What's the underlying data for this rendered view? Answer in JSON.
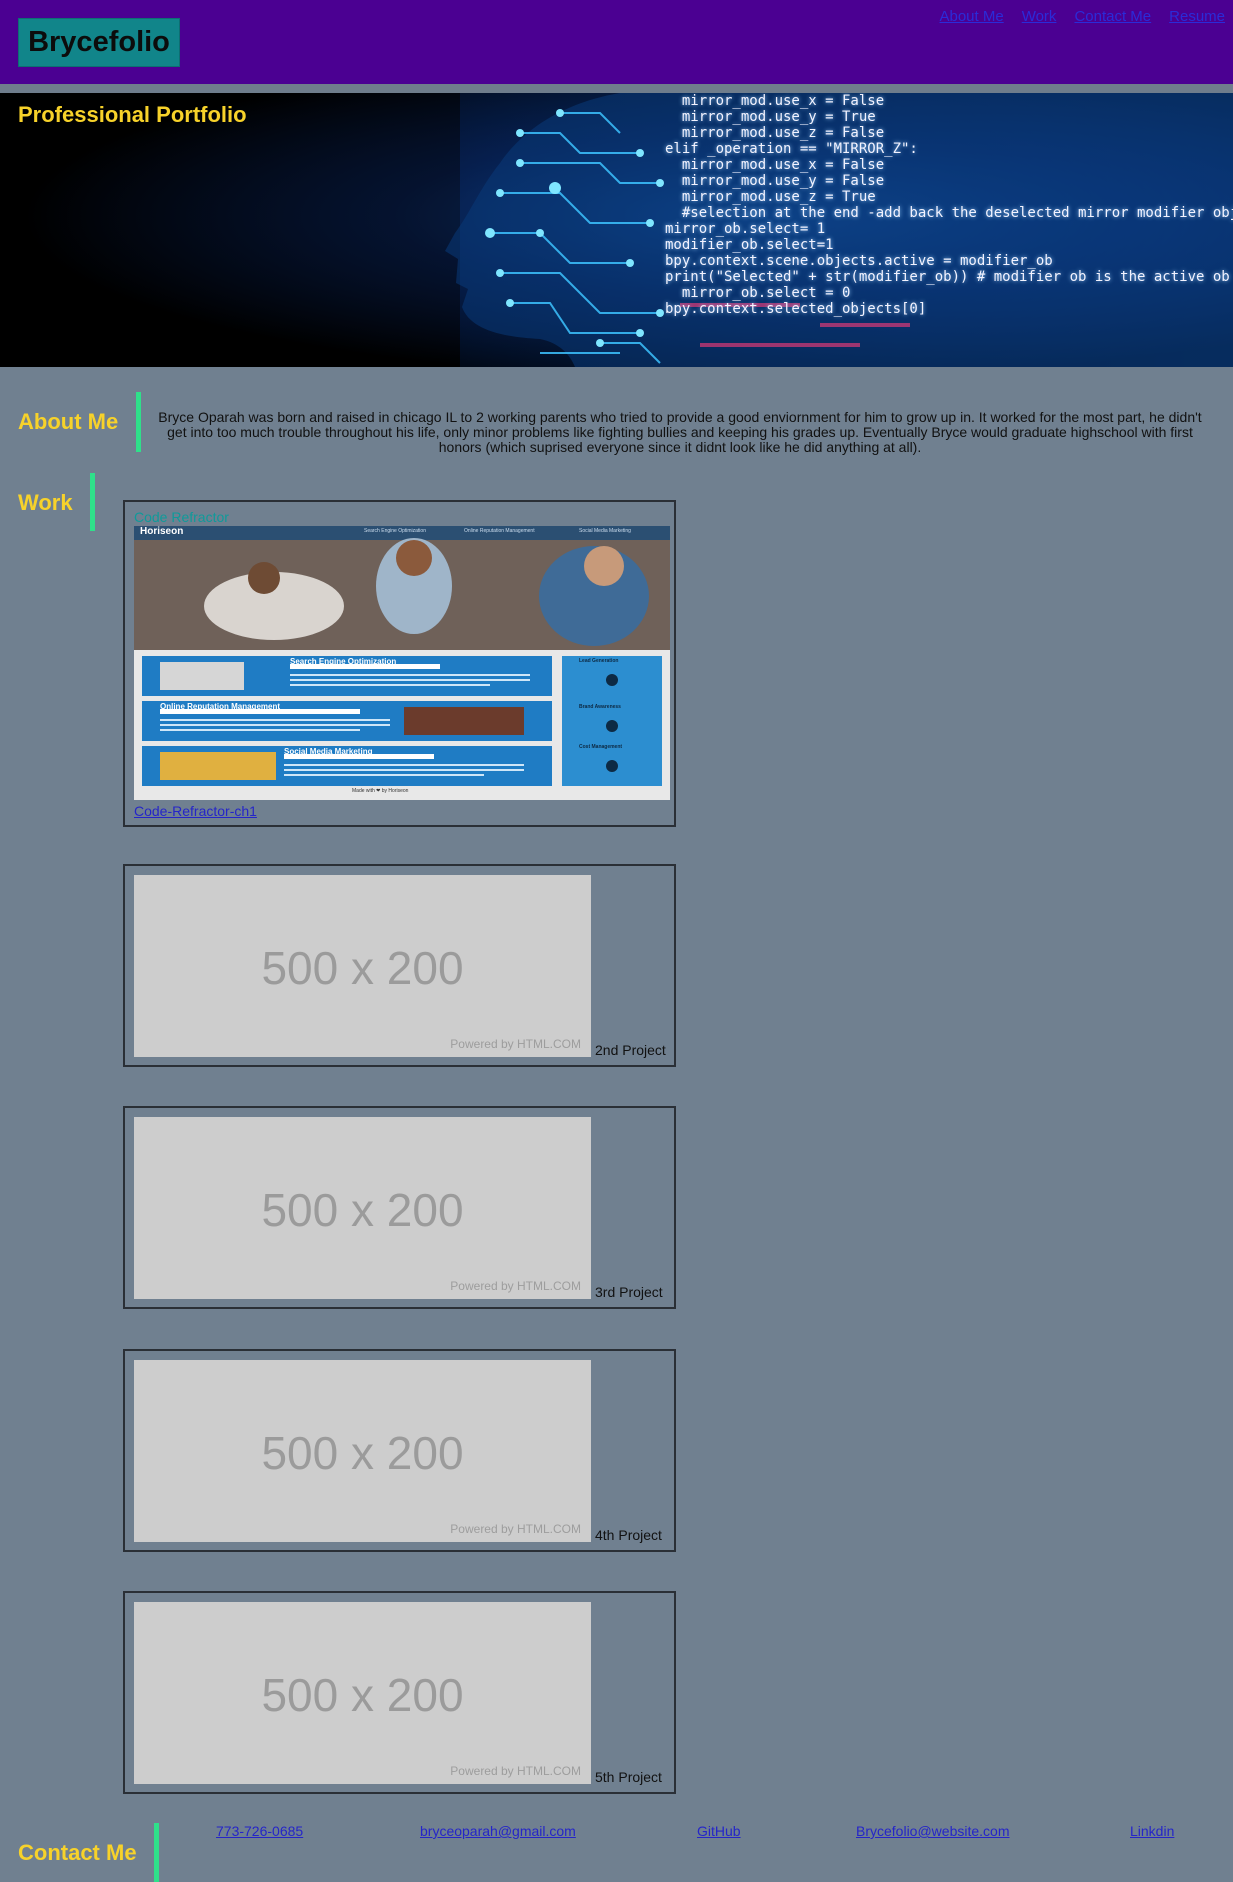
{
  "header": {
    "logo": "Brycefolio",
    "nav": [
      "About Me",
      "Work",
      "Contact Me",
      "Resume"
    ]
  },
  "hero": {
    "title": "Professional Portfolio",
    "code_lines": [
      "  mirror_mod.use_x = False",
      "  mirror_mod.use_y = True",
      "  mirror_mod.use_z = False",
      "elif _operation == \"MIRROR_Z\":",
      "  mirror_mod.use_x = False",
      "  mirror_mod.use_y = False",
      "  mirror_mod.use_z = True",
      "",
      "  #selection at the end -add back the deselected mirror modifier object",
      "mirror_ob.select= 1",
      "modifier_ob.select=1",
      "bpy.context.scene.objects.active = modifier_ob",
      "print(\"Selected\" + str(modifier_ob)) # modifier ob is the active ob",
      "  mirror_ob.select = 0",
      "bpy.context.selected_objects[0]"
    ]
  },
  "about": {
    "heading": "About Me",
    "text": "Bryce Oparah was born and raised in chicago IL to 2 working parents who tried to provide a good enviornment for him to grow up in. It worked for the most part, he didn't get into too much trouble throughout his life, only minor problems like fighting bullies and keeping his grades up. Eventually Bryce would graduate highschool with first honors (which suprised everyone since it didnt look like he did anything at all)."
  },
  "work": {
    "heading": "Work",
    "featured": {
      "title": "Code Refractor",
      "link": "Code-Refractor-ch1",
      "screenshot": {
        "brand": "Horiseon",
        "nav": [
          "Search Engine Optimization",
          "Online Reputation Management",
          "Social Media Marketing"
        ],
        "sections": [
          "Search Engine Optimization",
          "Online Reputation Management",
          "Social Media Marketing"
        ],
        "sidebar": [
          "Lead Generation",
          "Brand Awareness",
          "Cost Management"
        ],
        "footer": "Made with ❤ by Horiseon"
      }
    },
    "placeholders": [
      {
        "size": "500 x 200",
        "powered": "Powered by HTML.COM",
        "caption": "2nd Project"
      },
      {
        "size": "500 x 200",
        "powered": "Powered by HTML.COM",
        "caption": "3rd Project"
      },
      {
        "size": "500 x 200",
        "powered": "Powered by HTML.COM",
        "caption": "4th Project"
      },
      {
        "size": "500 x 200",
        "powered": "Powered by HTML.COM",
        "caption": "5th Project"
      }
    ]
  },
  "contact": {
    "heading": "Contact Me",
    "links": [
      "773-726-0685",
      "bryceoparah@gmail.com",
      "GitHub",
      "Brycefolio@website.com",
      "Linkdin"
    ]
  },
  "colors": {
    "background": "#708090",
    "header": "#4b0092",
    "accent_yellow": "#f7d22a",
    "accent_green": "#2fe08a",
    "logo_bg": "#11858a"
  }
}
